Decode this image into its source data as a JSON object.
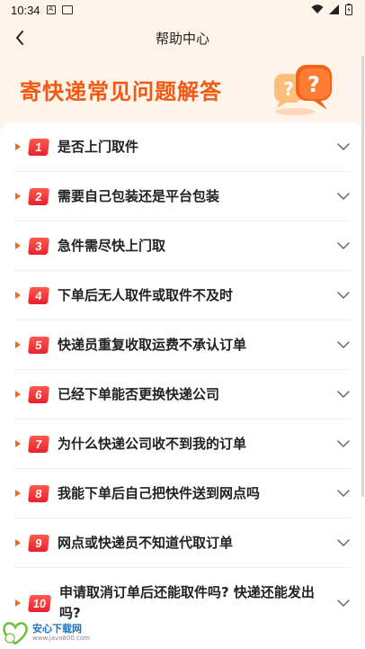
{
  "status_bar": {
    "time": "10:34",
    "icons": [
      "a-icon",
      "sim-icon",
      "wifi-icon",
      "signal-icon",
      "battery-icon"
    ]
  },
  "nav": {
    "title": "帮助中心",
    "back_icon": "chevron-left-icon"
  },
  "hero": {
    "title": "寄快递常见问题解答",
    "art_icon": "question-bubbles-icon"
  },
  "faq": [
    {
      "num": "1",
      "question": "是否上门取件"
    },
    {
      "num": "2",
      "question": "需要自己包装还是平台包装"
    },
    {
      "num": "3",
      "question": "急件需尽快上门取"
    },
    {
      "num": "4",
      "question": "下单后无人取件或取件不及时"
    },
    {
      "num": "5",
      "question": "快递员重复收取运费不承认订单"
    },
    {
      "num": "6",
      "question": "已经下单能否更换快递公司"
    },
    {
      "num": "7",
      "question": "为什么快递公司收不到我的订单"
    },
    {
      "num": "8",
      "question": "我能下单后自己把快件送到网点吗"
    },
    {
      "num": "9",
      "question": "网点或快递员不知道代取订单"
    },
    {
      "num": "10",
      "question": "申请取消订单后还能取件吗? 快递还能发出吗?"
    }
  ],
  "colors": {
    "accent": "#f05a16",
    "badge": "#e7212f",
    "hero_bg": "#fff4ea"
  },
  "watermark": {
    "main": "安心下载网",
    "sub": "www.java800.com"
  }
}
